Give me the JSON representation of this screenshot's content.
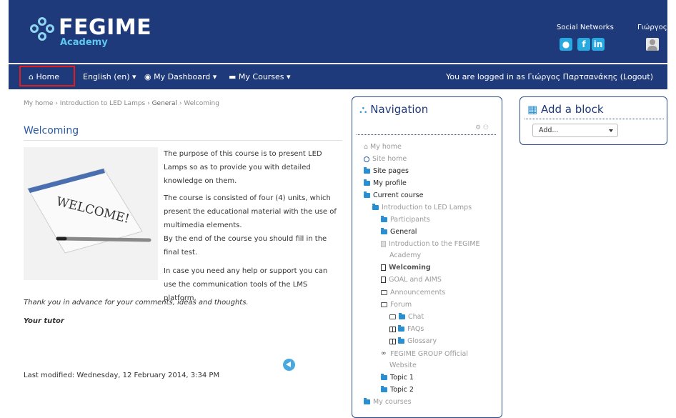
{
  "brand": {
    "name": "FEGIME",
    "sub": "Academy"
  },
  "header": {
    "social_label": "Social Networks",
    "user_label": "Γιώργος"
  },
  "navbar": {
    "home": "Home",
    "language": "English (en) ▾",
    "dashboard": "My Dashboard ▾",
    "courses": "My Courses ▾",
    "logged_prefix": "You are logged in as Γιώργος Παρτσανάκης (",
    "logout": "Logout",
    "logged_suffix": ")"
  },
  "breadcrumb": {
    "home": "My home",
    "sep": " › ",
    "course": "Introduction to LED Lamps",
    "section": "General",
    "page": "Welcoming"
  },
  "page": {
    "title": "Welcoming",
    "paragraphs": [
      "The purpose of this course is to present LED Lamps so as to provide you with detailed knowledge on them.",
      "The course is consisted of four (4) units, which present the educational material with the use of multimedia elements.",
      "By the end of the course you should fill in the final test.",
      "In case you need any help or support you can use the communication tools of the LMS platform."
    ],
    "thanks": "Thank you in advance for your comments, ideas and thoughts.",
    "signature": "Your tutor",
    "image_text": "WELCOME!",
    "modified": "Last modified: Wednesday, 12 February 2014, 3:34 PM"
  },
  "navigation": {
    "title": "Navigation",
    "items": [
      {
        "label": "My home",
        "icon": "home-icon",
        "muted": true
      },
      {
        "label": "Site home",
        "icon": "circle-icon",
        "muted": true
      },
      {
        "label": "Site pages",
        "icon": "folder-icon"
      },
      {
        "label": "My profile",
        "icon": "folder-icon"
      },
      {
        "label": "Current course",
        "icon": "folder-icon"
      },
      {
        "label": "Introduction to LED Lamps",
        "icon": "folder-icon",
        "muted": true
      },
      {
        "label": "Participants",
        "icon": "folder-icon",
        "muted": true
      },
      {
        "label": "General",
        "icon": "folder-icon"
      },
      {
        "label": "Introduction to the FEGIME",
        "icon": "image-icon",
        "muted": true
      },
      {
        "label": "Academy",
        "icon": "",
        "muted": true
      },
      {
        "label": "Welcoming",
        "icon": "page-icon",
        "bold": true
      },
      {
        "label": "GOAL and AIMS",
        "icon": "page-icon",
        "muted": true
      },
      {
        "label": "Announcements",
        "icon": "forum-icon",
        "muted": true
      },
      {
        "label": "Forum",
        "icon": "forum-icon",
        "muted": true
      },
      {
        "label": "Chat",
        "icon": "chat-icon",
        "muted": true
      },
      {
        "label": "FAQs",
        "icon": "book-icon",
        "muted": true
      },
      {
        "label": "Glossary",
        "icon": "book-icon",
        "muted": true
      },
      {
        "label": "FEGIME GROUP Official",
        "icon": "link-icon",
        "muted": true
      },
      {
        "label": "Website",
        "icon": "",
        "muted": true
      },
      {
        "label": "Topic 1",
        "icon": "folder-icon"
      },
      {
        "label": "Topic 2",
        "icon": "folder-icon"
      },
      {
        "label": "My courses",
        "icon": "folder-icon",
        "muted": true
      }
    ]
  },
  "add_block": {
    "title": "Add a block",
    "select_value": "Add..."
  }
}
